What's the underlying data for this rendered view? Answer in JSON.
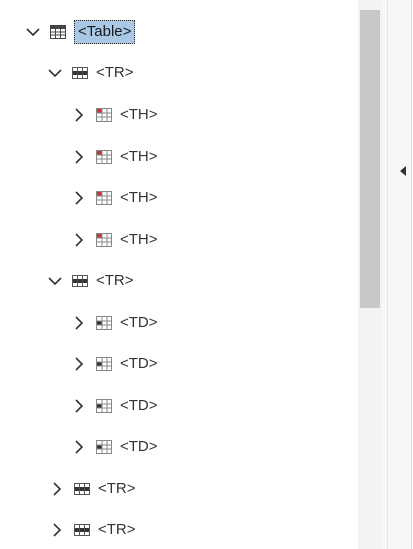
{
  "tree": {
    "nodes": [
      {
        "label": "<Table>",
        "expanded": true,
        "icon": "table-icon",
        "selected": true
      },
      {
        "label": "<TR>",
        "expanded": true,
        "icon": "table-row-icon"
      },
      {
        "label": "<TH>",
        "expanded": false,
        "icon": "table-header-cell-icon"
      },
      {
        "label": "<TH>",
        "expanded": false,
        "icon": "table-header-cell-icon"
      },
      {
        "label": "<TH>",
        "expanded": false,
        "icon": "table-header-cell-icon"
      },
      {
        "label": "<TH>",
        "expanded": false,
        "icon": "table-header-cell-icon"
      },
      {
        "label": "<TR>",
        "expanded": true,
        "icon": "table-row-icon"
      },
      {
        "label": "<TD>",
        "expanded": false,
        "icon": "table-data-cell-icon"
      },
      {
        "label": "<TD>",
        "expanded": false,
        "icon": "table-data-cell-icon"
      },
      {
        "label": "<TD>",
        "expanded": false,
        "icon": "table-data-cell-icon"
      },
      {
        "label": "<TD>",
        "expanded": false,
        "icon": "table-data-cell-icon"
      },
      {
        "label": "<TR>",
        "expanded": false,
        "icon": "table-row-icon"
      },
      {
        "label": "<TR>",
        "expanded": false,
        "icon": "table-row-icon"
      }
    ]
  },
  "colors": {
    "selection": "#a9c8e6",
    "text": "#333333",
    "scroll_thumb": "#c8c8c8",
    "header_cell_accent": "#c0392b"
  },
  "panel": {
    "collapse_icon": "triangle-left-icon"
  }
}
